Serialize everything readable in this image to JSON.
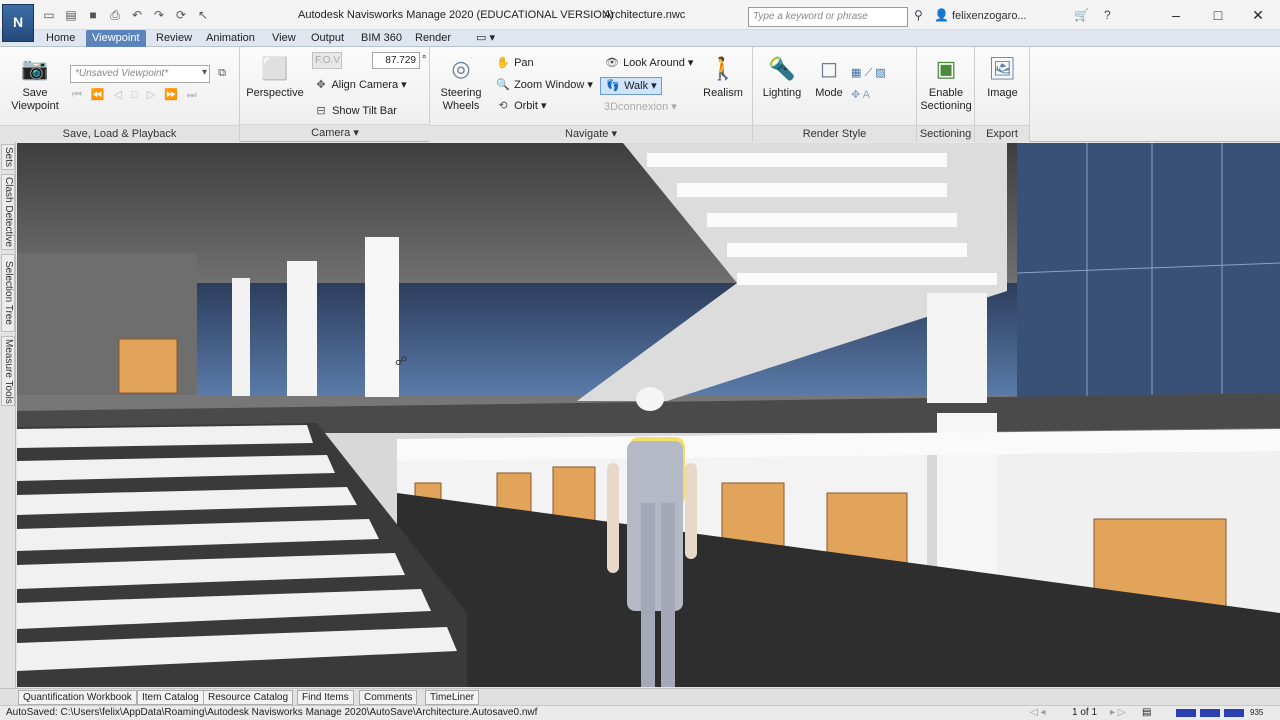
{
  "window": {
    "app_logo": "N",
    "title": "Autodesk Navisworks Manage 2020 (EDUCATIONAL VERSION)",
    "file": "Architecture.nwc",
    "search_placeholder": "Type a keyword or phrase",
    "user": "felixenzogaro..."
  },
  "tabs": [
    "Home",
    "Viewpoint",
    "Review",
    "Animation",
    "View",
    "Output",
    "BIM 360",
    "Render"
  ],
  "active_tab": "Viewpoint",
  "ribbon": {
    "save_load": {
      "save_viewpoint": "Save\nViewpoint",
      "viewpoint_combo": "*Unsaved Viewpoint*",
      "label": "Save, Load & Playback"
    },
    "camera": {
      "perspective": "Perspective",
      "fov_label": "F.O.V",
      "fov_value": "87.729",
      "fov_unit": "°",
      "align_camera": "Align Camera",
      "show_tilt_bar": "Show Tilt Bar",
      "label": "Camera"
    },
    "navigate": {
      "steering_wheels": "Steering\nWheels",
      "pan": "Pan",
      "zoom_window": "Zoom Window",
      "orbit": "Orbit",
      "look_around": "Look Around",
      "walk": "Walk",
      "connexion": "3Dconnexion",
      "realism": "Realism",
      "label": "Navigate"
    },
    "render_style": {
      "lighting": "Lighting",
      "mode": "Mode",
      "label": "Render Style"
    },
    "sectioning": {
      "enable": "Enable\nSectioning",
      "label": "Sectioning"
    },
    "export": {
      "image": "Image",
      "label": "Export"
    }
  },
  "side_tabs": [
    "Sets",
    "Clash Detective",
    "Selection Tree",
    "Measure Tools"
  ],
  "bottom_tabs": [
    "Quantification Workbook",
    "Item Catalog",
    "Resource Catalog",
    "Find Items",
    "Comments",
    "TimeLiner"
  ],
  "status": {
    "autosave": "AutoSaved: C:\\Users\\felix\\AppData\\Roaming\\Autodesk Navisworks Manage 2020\\AutoSave\\Architecture.Autosave0.nwf",
    "page": "1 of 1",
    "memory": "935"
  },
  "colors": {
    "accent": "#5b84bd",
    "panel_orange": "#e2a35a",
    "glass_blue": "#4f6e9b"
  }
}
